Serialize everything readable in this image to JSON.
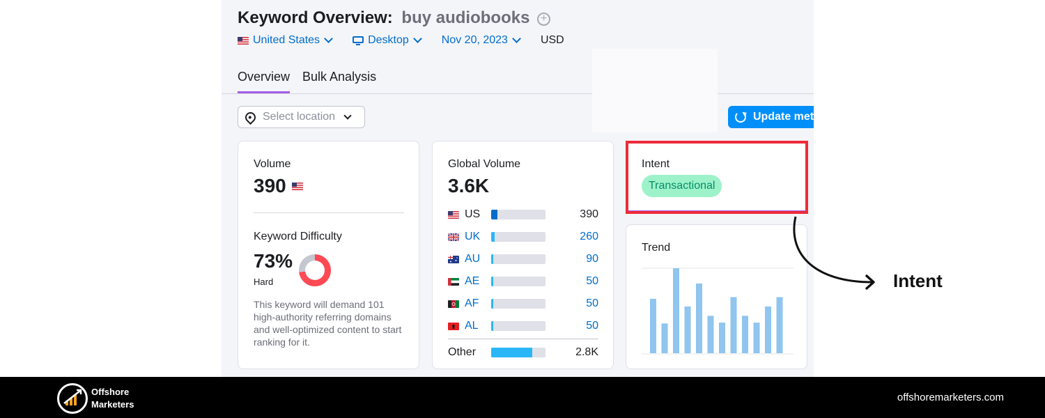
{
  "header": {
    "title_prefix": "Keyword Overview:",
    "keyword": "buy audiobooks",
    "add_icon": "plus-circle-icon"
  },
  "filters": {
    "country": "United States",
    "device": "Desktop",
    "date": "Nov 20, 2023",
    "currency": "USD"
  },
  "tabs": [
    {
      "label": "Overview",
      "active": true
    },
    {
      "label": "Bulk Analysis",
      "active": false
    }
  ],
  "location_select": {
    "placeholder": "Select location"
  },
  "update_button": {
    "label": "Update metrics"
  },
  "volume_card": {
    "label": "Volume",
    "value": "390"
  },
  "difficulty_card": {
    "label": "Keyword Difficulty",
    "value": "73%",
    "value_number": 73,
    "level": "Hard",
    "description": "This keyword will demand 101 high-authority referring domains and well-optimized content to start ranking for it."
  },
  "global_volume_card": {
    "label": "Global Volume",
    "value": "3.6K",
    "rows": [
      {
        "code": "US",
        "value": "390",
        "share": 0.11
      },
      {
        "code": "UK",
        "value": "260",
        "share": 0.07
      },
      {
        "code": "AU",
        "value": "90",
        "share": 0.03
      },
      {
        "code": "AE",
        "value": "50",
        "share": 0.02
      },
      {
        "code": "AF",
        "value": "50",
        "share": 0.02
      },
      {
        "code": "AL",
        "value": "50",
        "share": 0.02
      }
    ],
    "other": {
      "label": "Other",
      "value": "2.8K",
      "share": 0.76
    }
  },
  "intent_card": {
    "label": "Intent",
    "badge": "Transactional"
  },
  "trend_card": {
    "label": "Trend"
  },
  "chart_data": {
    "type": "bar",
    "values": [
      0.64,
      0.35,
      1.0,
      0.55,
      0.82,
      0.44,
      0.36,
      0.66,
      0.44,
      0.36,
      0.55,
      0.66
    ]
  },
  "annotation": {
    "label": "Intent"
  },
  "footer": {
    "brand_line1": "Offshore",
    "brand_line2": "Marketers",
    "website": "offshoremarketers.com"
  },
  "colors": {
    "accent_blue": "#006dca",
    "button_blue": "#008ff8",
    "purple": "#a35dea",
    "highlight_red": "#ee2b3a",
    "badge_green": "#9ef2c9",
    "trend_bar": "#8fc5ee"
  }
}
